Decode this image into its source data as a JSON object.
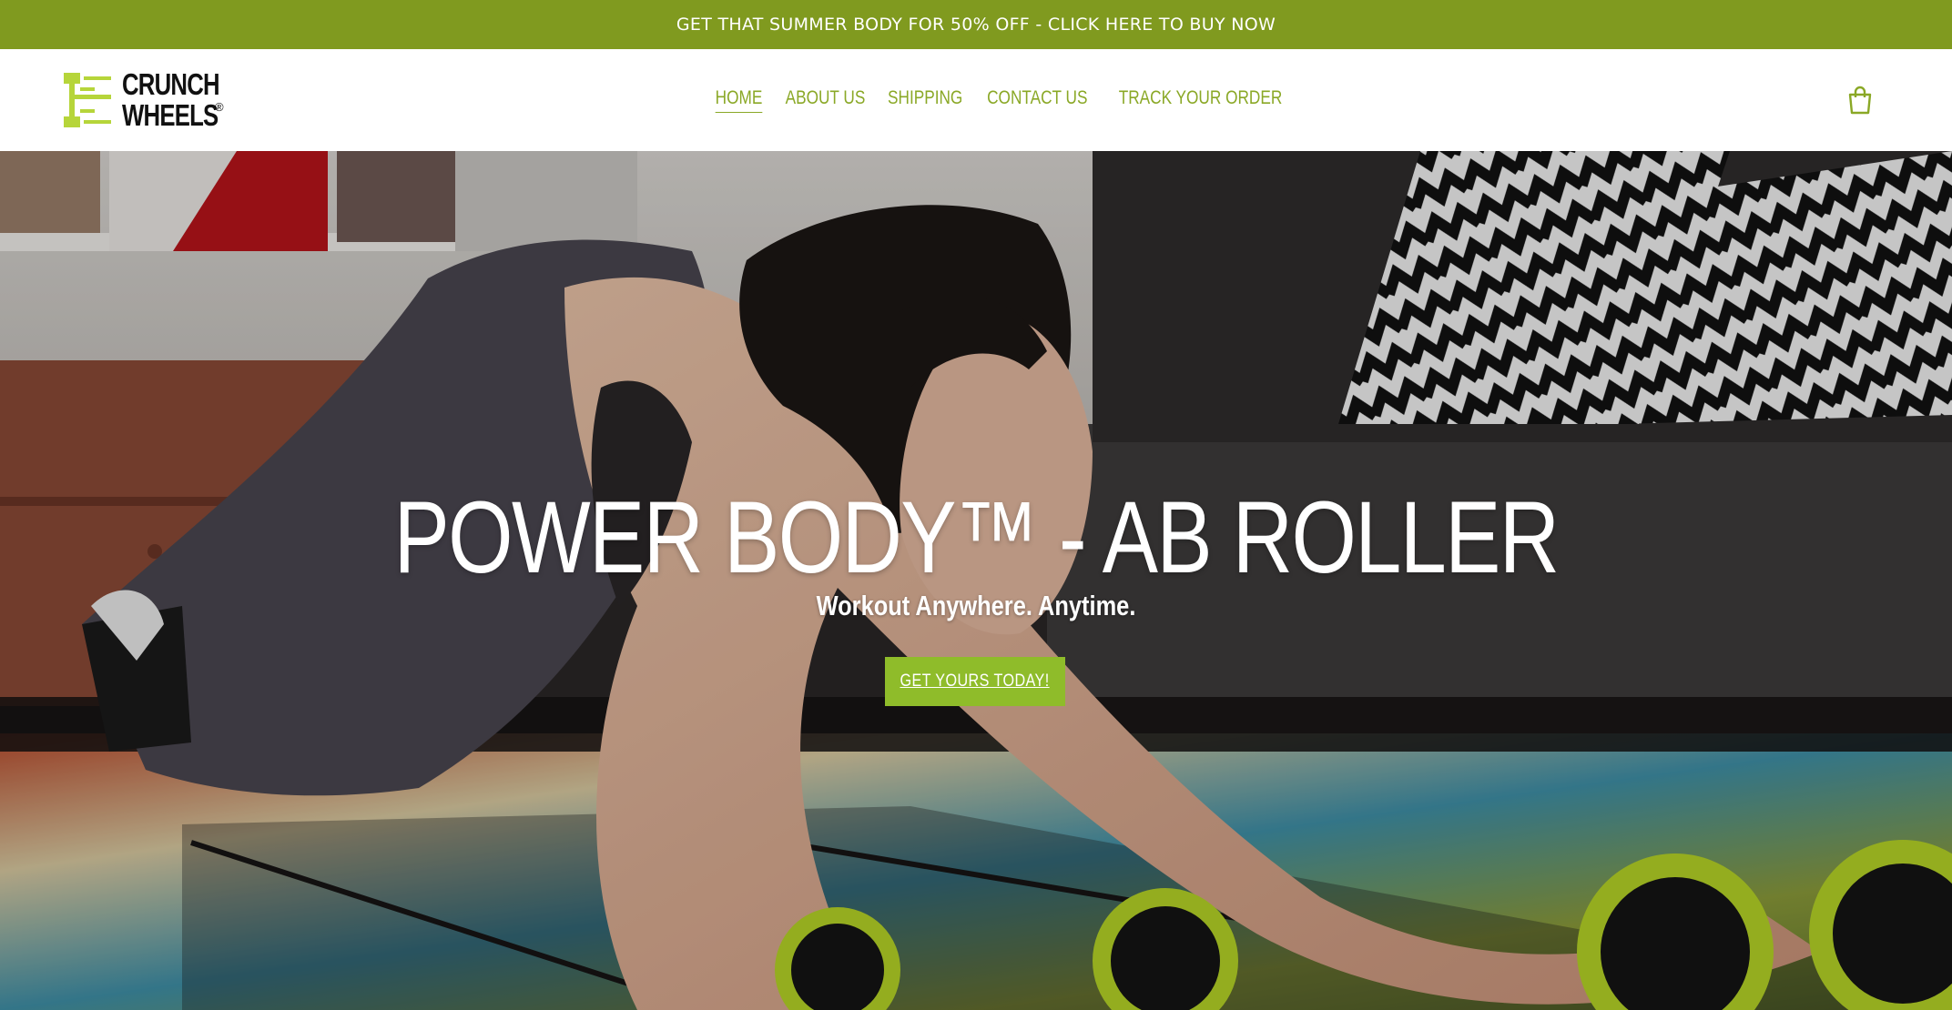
{
  "announcement": {
    "text": "GET THAT SUMMER BODY FOR 50% OFF - CLICK HERE TO BUY NOW"
  },
  "brand": {
    "line1": "CRUNCH",
    "line2": "WHEELS",
    "registered": "®",
    "logo_icon": "dumbbell-icon"
  },
  "nav": {
    "items": [
      {
        "label": "HOME",
        "active": true
      },
      {
        "label": "ABOUT US",
        "active": false
      },
      {
        "label": "SHIPPING",
        "active": false
      },
      {
        "label": "CONTACT US",
        "active": false
      },
      {
        "label": "TRACK YOUR ORDER",
        "active": false
      }
    ]
  },
  "header": {
    "cart_icon": "shopping-bag-icon"
  },
  "hero": {
    "title": "POWER BODY™  - AB ROLLER",
    "subtitle": "Workout Anywhere. Anytime.",
    "cta_label": "GET YOURS TODAY!"
  },
  "colors": {
    "accent": "#809a1f",
    "nav_link": "#8aa826",
    "button": "#8fbc2a",
    "logo_lime": "#b6d53a"
  }
}
